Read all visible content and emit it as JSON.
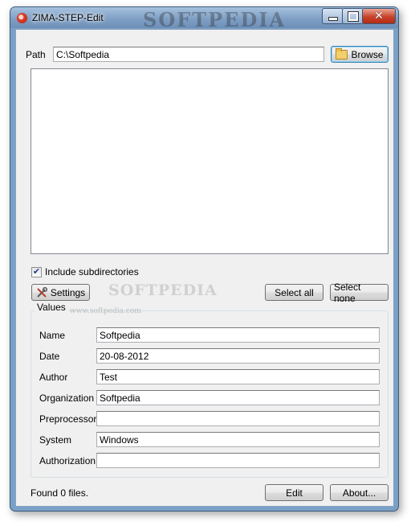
{
  "window": {
    "title": "ZIMA-STEP-Edit",
    "title_watermark": "SOFTPEDIA",
    "controls": {
      "minimize": "minimize",
      "maximize": "maximize",
      "close": "✕"
    }
  },
  "path": {
    "label": "Path",
    "value": "C:\\Softpedia",
    "browse_label": "Browse"
  },
  "files_list": {
    "items": []
  },
  "include_subdirectories": {
    "label": "Include subdirectories",
    "checked": true,
    "check_glyph": "✔"
  },
  "buttons": {
    "settings": "Settings",
    "select_all": "Select all",
    "select_none": "Select none",
    "edit": "Edit",
    "about": "About..."
  },
  "watermark": {
    "brand": "SOFTPEDIA",
    "url": "www.softpedia.com"
  },
  "values": {
    "title": "Values",
    "fields": [
      {
        "label": "Name",
        "value": "Softpedia"
      },
      {
        "label": "Date",
        "value": "20-08-2012"
      },
      {
        "label": "Author",
        "value": "Test"
      },
      {
        "label": "Organization",
        "value": "Softpedia"
      },
      {
        "label": "Preprocessor",
        "value": ""
      },
      {
        "label": "System",
        "value": "Windows"
      },
      {
        "label": "Authorization",
        "value": ""
      }
    ]
  },
  "status": {
    "text": "Found 0 files."
  },
  "colors": {
    "title_bar": "#7f9fc4",
    "client_bg": "#f0f0f0",
    "close_button": "#c9432b"
  }
}
